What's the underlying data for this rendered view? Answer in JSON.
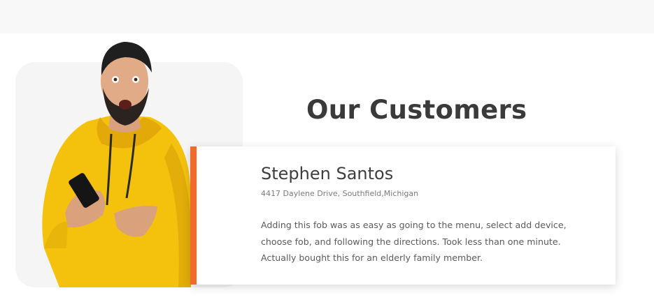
{
  "section": {
    "title": "Our Customers"
  },
  "testimonial": {
    "name": "Stephen Santos",
    "address": "4417 Daylene Drive, Southfield,Michigan",
    "quote_lines": [
      "Adding this fob was as easy as going to the menu, select add device,",
      "choose fob, and following the directions. Took less than one minute.",
      "Actually bought this for an elderly family member."
    ]
  },
  "colors": {
    "accent": "#f26a2b",
    "hoodie": "#f4c20d",
    "title_text": "#3a3a3a"
  },
  "image": {
    "icon": "customer-photo-icon"
  }
}
